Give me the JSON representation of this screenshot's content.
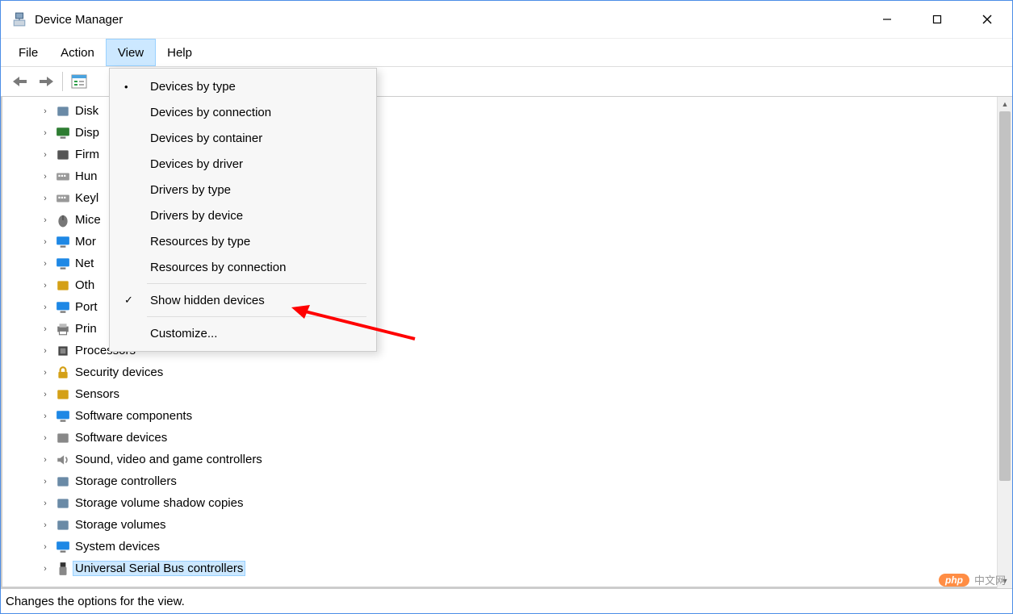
{
  "window": {
    "title": "Device Manager"
  },
  "menubar": [
    {
      "label": "File",
      "active": false
    },
    {
      "label": "Action",
      "active": false
    },
    {
      "label": "View",
      "active": true
    },
    {
      "label": "Help",
      "active": false
    }
  ],
  "view_menu": {
    "items": [
      {
        "label": "Devices by type",
        "marker": "•",
        "sep_after": false
      },
      {
        "label": "Devices by connection",
        "marker": "",
        "sep_after": false
      },
      {
        "label": "Devices by container",
        "marker": "",
        "sep_after": false
      },
      {
        "label": "Devices by driver",
        "marker": "",
        "sep_after": false
      },
      {
        "label": "Drivers by type",
        "marker": "",
        "sep_after": false
      },
      {
        "label": "Drivers by device",
        "marker": "",
        "sep_after": false
      },
      {
        "label": "Resources by type",
        "marker": "",
        "sep_after": false
      },
      {
        "label": "Resources by connection",
        "marker": "",
        "sep_after": true
      },
      {
        "label": "Show hidden devices",
        "marker": "✓",
        "sep_after": true
      },
      {
        "label": "Customize...",
        "marker": "",
        "sep_after": false
      }
    ]
  },
  "tree": {
    "items": [
      {
        "label": "Disk",
        "icon": "disk",
        "selected": false
      },
      {
        "label": "Disp",
        "icon": "display",
        "selected": false
      },
      {
        "label": "Firm",
        "icon": "firmware",
        "selected": false
      },
      {
        "label": "Hun",
        "icon": "keyboard",
        "selected": false
      },
      {
        "label": "Keyl",
        "icon": "keyboard",
        "selected": false
      },
      {
        "label": "Mice",
        "icon": "mouse",
        "selected": false
      },
      {
        "label": "Mor",
        "icon": "monitor",
        "selected": false
      },
      {
        "label": "Net",
        "icon": "network",
        "selected": false
      },
      {
        "label": "Oth",
        "icon": "other",
        "selected": false
      },
      {
        "label": "Port",
        "icon": "port",
        "selected": false
      },
      {
        "label": "Prin",
        "icon": "printer",
        "selected": false
      },
      {
        "label": "Processors",
        "icon": "cpu",
        "selected": false
      },
      {
        "label": "Security devices",
        "icon": "security",
        "selected": false
      },
      {
        "label": "Sensors",
        "icon": "sensor",
        "selected": false
      },
      {
        "label": "Software components",
        "icon": "component",
        "selected": false
      },
      {
        "label": "Software devices",
        "icon": "software",
        "selected": false
      },
      {
        "label": "Sound, video and game controllers",
        "icon": "sound",
        "selected": false
      },
      {
        "label": "Storage controllers",
        "icon": "storage",
        "selected": false
      },
      {
        "label": "Storage volume shadow copies",
        "icon": "volume",
        "selected": false
      },
      {
        "label": "Storage volumes",
        "icon": "volume",
        "selected": false
      },
      {
        "label": "System devices",
        "icon": "system",
        "selected": false
      },
      {
        "label": "Universal Serial Bus controllers",
        "icon": "usb",
        "selected": true
      }
    ]
  },
  "statusbar": {
    "text": "Changes the options for the view."
  },
  "watermark": {
    "badge": "php",
    "text": "中文网"
  },
  "icons": {
    "disk": "#6a8aa6",
    "display": "#2e7d32",
    "firmware": "#555555",
    "keyboard": "#777777",
    "mouse": "#555555",
    "monitor": "#1e88e5",
    "network": "#1e88e5",
    "other": "#d4a017",
    "port": "#1e88e5",
    "printer": "#666666",
    "cpu": "#444444",
    "security": "#d4a017",
    "sensor": "#d4a017",
    "component": "#1e88e5",
    "software": "#888888",
    "sound": "#888888",
    "storage": "#6a8aa6",
    "volume": "#6a8aa6",
    "system": "#1e88e5",
    "usb": "#333333"
  }
}
